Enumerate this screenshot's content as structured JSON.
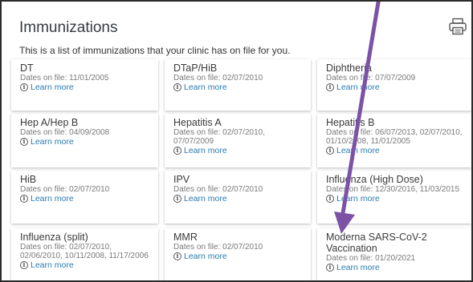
{
  "page": {
    "title": "Immunizations",
    "intro": "This is a list of immunizations that your clinic has on file for you.",
    "print_icon": "print-icon",
    "learn_more_label": "Learn more",
    "info_icon": "info-icon"
  },
  "cards": [
    {
      "name": "DT",
      "dates": "Dates on file: 11/01/2005"
    },
    {
      "name": "DTaP/HiB",
      "dates": "Dates on file: 02/07/2010"
    },
    {
      "name": "Diphtheria",
      "dates": "Dates on file: 07/07/2009"
    },
    {
      "name": "Hep A/Hep B",
      "dates": "Dates on file: 04/09/2008"
    },
    {
      "name": "Hepatitis A",
      "dates": "Dates on file: 02/07/2010, 07/07/2009"
    },
    {
      "name": "Hepatitis B",
      "dates": "Dates on file: 06/07/2013, 02/07/2010, 01/10/2008, 11/01/2005"
    },
    {
      "name": "HiB",
      "dates": "Dates on file: 02/07/2010"
    },
    {
      "name": "IPV",
      "dates": "Dates on file: 02/07/2010"
    },
    {
      "name": "Influenza (High Dose)",
      "dates": "Dates on file: 12/30/2016, 11/03/2015"
    },
    {
      "name": "Influenza (split)",
      "dates": "Dates on file: 02/07/2010, 02/06/2010, 10/11/2008, 11/17/2006"
    },
    {
      "name": "MMR",
      "dates": "Dates on file: 02/07/2010"
    },
    {
      "name": "Moderna SARS-CoV-2 Vaccination",
      "dates": "Dates on file: 01/20/2021"
    }
  ],
  "colors": {
    "arrow": "#7b52a6",
    "link": "#2a7ab0"
  }
}
